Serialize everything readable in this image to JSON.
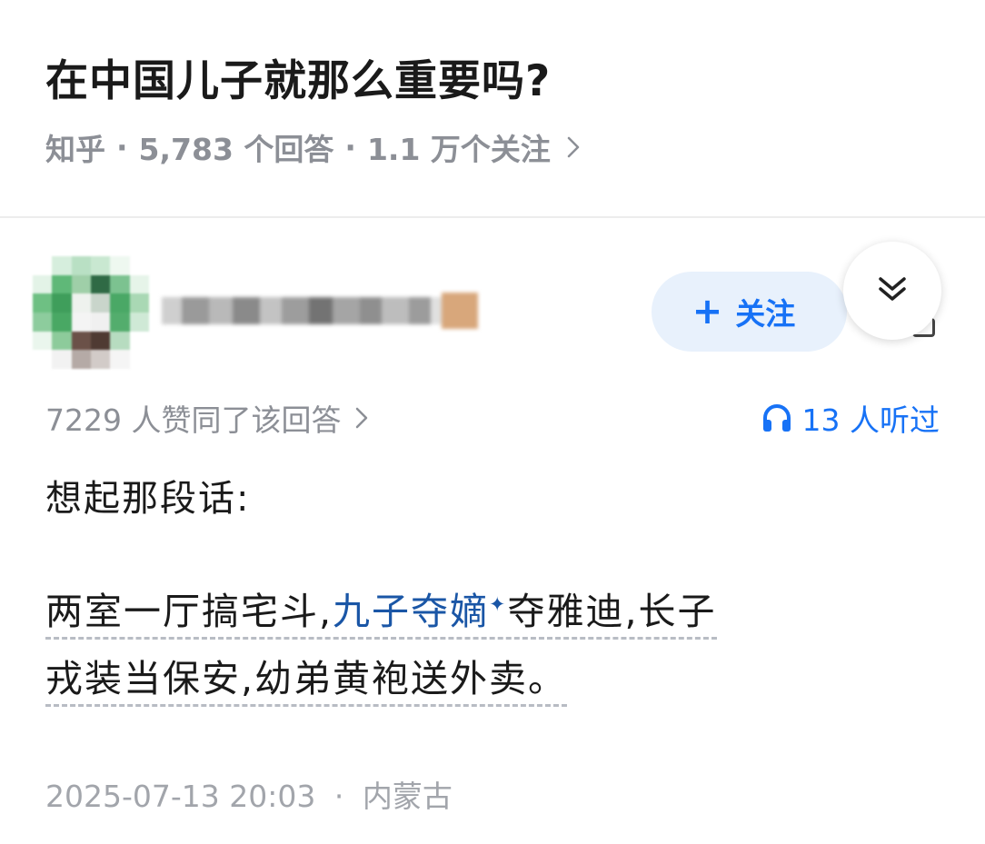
{
  "question": {
    "title": "在中国儿子就那么重要吗?",
    "source": "知乎",
    "answers": "5,783 个回答",
    "followers": "1.1 万个关注"
  },
  "author": {
    "follow_label": "关注"
  },
  "answer": {
    "upvotes": "7229 人赞同了该回答",
    "listens": "13 人听过",
    "intro": "想起那段话:",
    "body_before": "两室一厅搞宅斗,",
    "body_link": "九子夺嫡",
    "body_after_line1": "夺雅迪,长子",
    "body_line2": "戎装当保安,幼弟黄袍送外卖。",
    "date": "2025-07-13 20:03",
    "location": "内蒙古"
  },
  "colors": {
    "accent": "#1772f6",
    "link": "#1a56a6",
    "muted": "#8c8f96"
  }
}
